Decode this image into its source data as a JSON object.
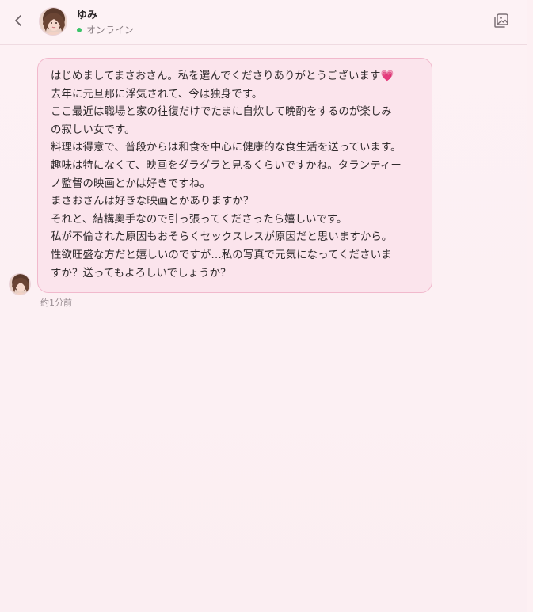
{
  "header": {
    "name": "ゆみ",
    "status": "オンライン",
    "status_color": "#3cc46a"
  },
  "icons": {
    "back": "chevron-left-icon",
    "gallery": "photo-gallery-icon",
    "avatar": "profile-avatar"
  },
  "message": {
    "lines": [
      "はじめましてまさおさん。私を選んでくださりありがとうございます",
      "去年に元旦那に浮気されて、今は独身です。",
      "ここ最近は職場と家の往復だけでたまに自炊して晩酌をするのが楽しみ",
      "の寂しい女です。",
      "料理は得意で、普段からは和食を中心に健康的な食生活を送っています。",
      "趣味は特になくて、映画をダラダラと見るくらいですかね。タランティー",
      "ノ監督の映画とかは好きですね。",
      "まさおさんは好きな映画とかありますか？",
      "それと、結構奥手なので引っ張ってくださったら嬉しいです。",
      "私が不倫された原因もおそらくセックスレスが原因だと思いますから。",
      "性欲旺盛な方だと嬉しいのですが…私の写真で元気になってくださいま",
      "すか？送ってもよろしいでしょうか？"
    ],
    "heart": "💗",
    "timestamp": "約1分前"
  },
  "colors": {
    "bubble_bg": "#fbe4ec",
    "bubble_border": "#f1b9cc",
    "page_bg": "#fdf0f3"
  }
}
